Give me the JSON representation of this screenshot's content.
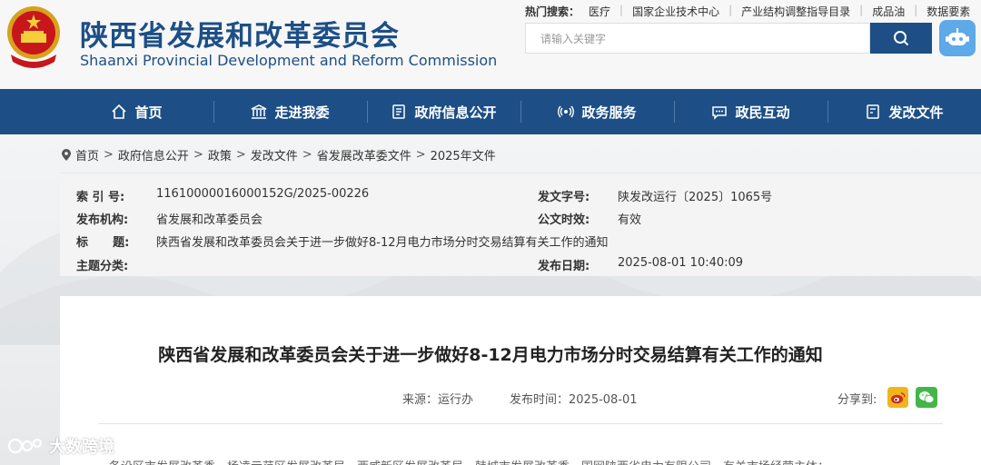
{
  "header": {
    "site_name_cn": "陕西省发展和改革委员会",
    "site_name_en": "Shaanxi Provincial Development and Reform Commission",
    "hot_search_label": "热门搜索：",
    "hot_search_items": [
      "医疗",
      "国家企业技术中心",
      "产业结构调整指导目录",
      "成品油",
      "数据要素"
    ],
    "search_placeholder": "请输入关键字"
  },
  "nav": {
    "items": [
      {
        "label": "首页",
        "icon": "home-icon"
      },
      {
        "label": "走进我委",
        "icon": "building-icon"
      },
      {
        "label": "政府信息公开",
        "icon": "document-icon"
      },
      {
        "label": "政务服务",
        "icon": "service-icon"
      },
      {
        "label": "政民互动",
        "icon": "chat-icon"
      },
      {
        "label": "发改文件",
        "icon": "file-icon"
      }
    ]
  },
  "breadcrumb": [
    "首页",
    "政府信息公开",
    "政策",
    "发改文件",
    "省发展改革委文件",
    "2025年文件"
  ],
  "info": {
    "index_label": "索 引 号:",
    "index_value": "11610000016000152G/2025-00226",
    "issuer_label": "发布机构:",
    "issuer_value": "省发展和改革委员会",
    "title_label": "标      题:",
    "title_value": "陕西省发展和改革委员会关于进一步做好8-12月电力市场分时交易结算有关工作的通知",
    "topic_label": "主题分类:",
    "topic_value": "",
    "docno_label": "发文字号:",
    "docno_value": "陕发改运行〔2025〕1065号",
    "validity_label": "公文时效:",
    "validity_value": "有效",
    "date_label": "发布日期:",
    "date_value": "2025-08-01 10:40:09"
  },
  "article": {
    "title": "陕西省发展和改革委员会关于进一步做好8-12月电力市场分时交易结算有关工作的通知",
    "source": "来源：运行办",
    "publish_time": "发布时间：2025-08-01",
    "share_label": "分享到:",
    "body_first_line": "各设区市发展改革委，杨凌示范区发展改革局，西咸新区发展改革局，韩城市发展改革委，国网陕西省电力有限公司，有关市场经营主体："
  },
  "watermark": {
    "text": "大数跨境"
  },
  "colors": {
    "brand": "#1d4f86",
    "weibo": "#f1b51c",
    "wechat": "#44b549"
  }
}
